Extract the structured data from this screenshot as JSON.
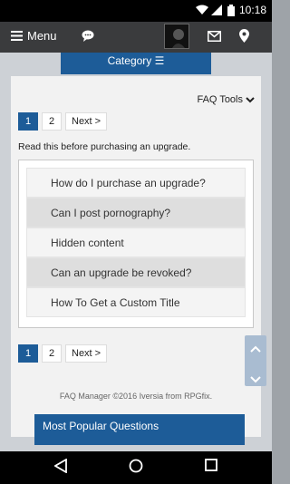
{
  "status_bar": {
    "time": "10:18"
  },
  "header": {
    "menu_label": "Menu"
  },
  "category": {
    "label": "Category ☰"
  },
  "faq_tools": {
    "label": "FAQ Tools"
  },
  "pagination": {
    "pages": [
      "1",
      "2"
    ],
    "next_label": "Next >",
    "active_page": "1"
  },
  "notice": "Read this before purchasing an upgrade.",
  "questions": [
    "How do I purchase an upgrade?",
    "Can I post pornography?",
    "Hidden content",
    "Can an upgrade be revoked?",
    "How To Get a Custom Title"
  ],
  "footer": {
    "text": "FAQ Manager ©2016 Iversia from RPGfix."
  },
  "popular": {
    "title": "Most Popular Questions"
  },
  "colors": {
    "accent": "#1d5c98",
    "header_bg": "#3a3b3d",
    "content_bg": "#cdd1d6"
  }
}
